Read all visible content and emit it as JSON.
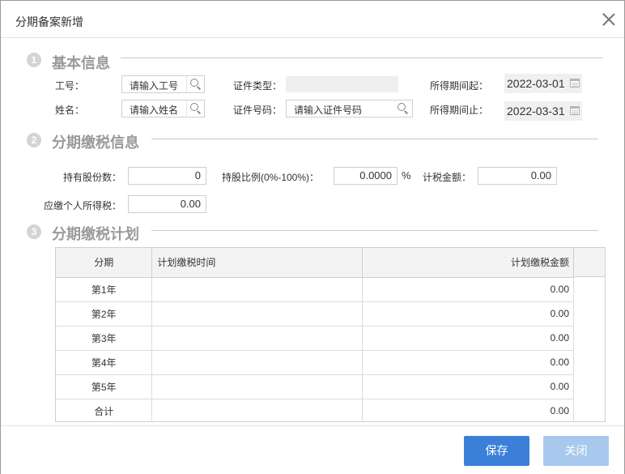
{
  "dialog": {
    "title": "分期备案新增"
  },
  "sections": [
    {
      "num": "1",
      "title": "基本信息"
    },
    {
      "num": "2",
      "title": "分期缴税信息"
    },
    {
      "num": "3",
      "title": "分期缴税计划"
    }
  ],
  "basic": {
    "emp_no_label": "工号：",
    "emp_no_placeholder": "请输入工号",
    "name_label": "姓名：",
    "name_placeholder": "请输入姓名",
    "id_type_label": "证件类型：",
    "id_type_value": "",
    "id_no_label": "证件号码：",
    "id_no_placeholder": "请输入证件号码",
    "period_start_label": "所得期间起：",
    "period_start_value": "2022-03-01",
    "period_end_label": "所得期间止：",
    "period_end_value": "2022-03-31"
  },
  "tax": {
    "shares_label": "持有股份数：",
    "shares_value": "0",
    "ratio_label": "持股比例(0%-100%)：",
    "ratio_value": "0.0000",
    "ratio_unit": "%",
    "taxable_label": "计税金额：",
    "taxable_value": "0.00",
    "payable_label": "应缴个人所得税：",
    "payable_value": "0.00"
  },
  "plan": {
    "headers": [
      "分期",
      "计划缴税时间",
      "计划缴税金额"
    ],
    "rows": [
      {
        "period": "第1年",
        "time": "",
        "amount": "0.00"
      },
      {
        "period": "第2年",
        "time": "",
        "amount": "0.00"
      },
      {
        "period": "第3年",
        "time": "",
        "amount": "0.00"
      },
      {
        "period": "第4年",
        "time": "",
        "amount": "0.00"
      },
      {
        "period": "第5年",
        "time": "",
        "amount": "0.00"
      },
      {
        "period": "合计",
        "time": "",
        "amount": "0.00"
      }
    ]
  },
  "footer": {
    "save_label": "保存",
    "close_label": "关闭"
  },
  "colors": {
    "primary": "#3b7fd9",
    "primary_disabled": "#a9c8ed",
    "section_gray": "#9a9a9a"
  },
  "icons": {
    "search": "search-icon",
    "calendar": "calendar-icon",
    "close": "close-icon"
  }
}
